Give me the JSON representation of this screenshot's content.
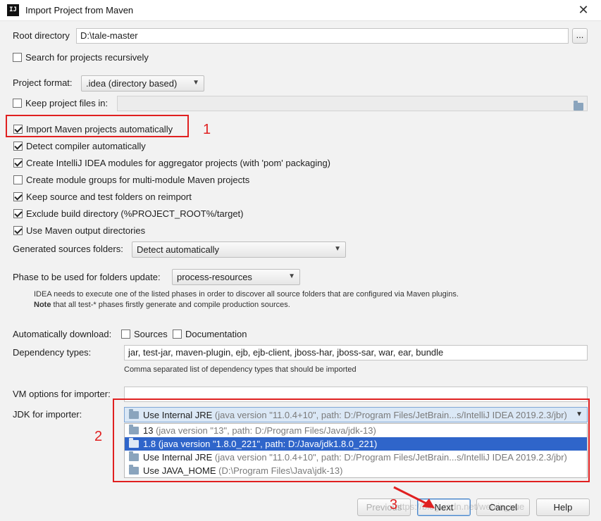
{
  "window": {
    "app_icon": "IJ",
    "title": "Import Project from Maven",
    "close_glyph": "✕"
  },
  "root_directory": {
    "label": "Root directory",
    "value": "D:\\tale-master",
    "browse_label": "..."
  },
  "search_recursive": {
    "label": "Search for projects recursively",
    "checked": false
  },
  "project_format": {
    "label": "Project format:",
    "value": ".idea (directory based)"
  },
  "keep_project_files": {
    "label": "Keep project files in:",
    "checked": false,
    "value": "",
    "icon": "folder-icon"
  },
  "options": [
    {
      "label": "Import Maven projects automatically",
      "checked": true
    },
    {
      "label": "Detect compiler automatically",
      "checked": true
    },
    {
      "label": "Create IntelliJ IDEA modules for aggregator projects (with 'pom' packaging)",
      "checked": true
    },
    {
      "label": "Create module groups for multi-module Maven projects",
      "checked": false
    },
    {
      "label": "Keep source and test folders on reimport",
      "checked": true
    },
    {
      "label": "Exclude build directory (%PROJECT_ROOT%/target)",
      "checked": true
    },
    {
      "label": "Use Maven output directories",
      "checked": true
    }
  ],
  "generated_sources": {
    "label": "Generated sources folders:",
    "value": "Detect automatically"
  },
  "phase": {
    "label": "Phase to be used for folders update:",
    "value": "process-resources",
    "hint_line1": "IDEA needs to execute one of the listed phases in order to discover all source folders that are configured via Maven plugins.",
    "hint_note_bold": "Note",
    "hint_line2": " that all test-* phases firstly generate and compile production sources."
  },
  "auto_download": {
    "label": "Automatically download:",
    "sources_label": "Sources",
    "sources_checked": false,
    "docs_label": "Documentation",
    "docs_checked": false
  },
  "dependency_types": {
    "label": "Dependency types:",
    "value": "jar, test-jar, maven-plugin, ejb, ejb-client, jboss-har, jboss-sar, war, ear, bundle",
    "hint": "Comma separated list of dependency types that should be imported"
  },
  "vm_options": {
    "label": "VM options for importer:",
    "value": ""
  },
  "jdk": {
    "label": "JDK for importer:",
    "selected": {
      "name": "Use Internal JRE",
      "detail": "(java version \"11.0.4+10\", path: D:/Program Files/JetBrain...s/IntelliJ IDEA 2019.2.3/jbr)"
    },
    "items": [
      {
        "name": "13",
        "detail": "(java version \"13\", path: D:/Program Files/Java/jdk-13)",
        "selected": false
      },
      {
        "name": "1.8",
        "detail": "(java version \"1.8.0_221\", path: D:/Java/jdk1.8.0_221)",
        "selected": true
      },
      {
        "name": "Use Internal JRE",
        "detail": "(java version \"11.0.4+10\", path: D:/Program Files/JetBrain...s/IntelliJ IDEA 2019.2.3/jbr)",
        "selected": false
      },
      {
        "name": "Use JAVA_HOME",
        "detail": "(D:\\Program Files\\Java\\jdk-13)",
        "selected": false
      }
    ]
  },
  "buttons": {
    "previous": "Previous",
    "next": "Next",
    "cancel": "Cancel",
    "help": "Help"
  },
  "annotations": {
    "mark1": "1",
    "mark2": "2",
    "mark3": "3",
    "color": "#e02020"
  },
  "watermark": "https://blog.csdn.net/weixin_xue"
}
